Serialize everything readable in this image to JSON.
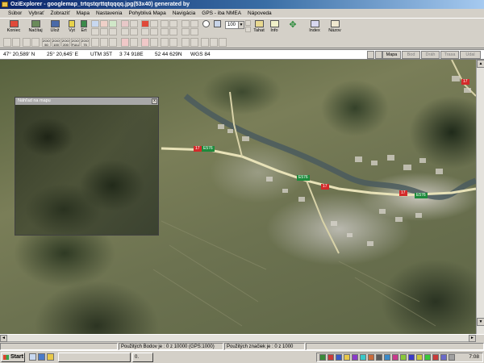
{
  "window": {
    "title": "OziExplorer - googlemap_trtqstqrttqtqqqq.jpg(53x40) generated by"
  },
  "menu": [
    "Súbor",
    "Vybrať",
    "Zobraziť",
    "Mapa",
    "Nastavenia",
    "Pohyblivá Mapa",
    "Navigácia",
    "GPS - iba NMEA",
    "Nápoveda"
  ],
  "toolbar": {
    "buttons": [
      {
        "label": "Koniec",
        "icon": "exit-icon"
      },
      {
        "label": "Načítaj",
        "icon": "load-map-icon"
      },
      {
        "label": "Ulož",
        "icon": "save-icon"
      },
      {
        "label": "Vyt",
        "icon": "create-icon"
      },
      {
        "label": "Ert",
        "icon": "edit-icon"
      },
      {
        "label": "Tahat",
        "icon": "drag-hand-icon"
      },
      {
        "label": "Info",
        "icon": "info-icon"
      },
      {
        "label": "Index",
        "icon": "index-icon"
      },
      {
        "label": "Názov",
        "icon": "name-search-icon"
      }
    ],
    "zoom_value": "100",
    "row2_labels": [
      "ZOOM 50",
      "ZOOM 100",
      "ZOOM 200",
      "ZOOM FULL",
      "ZOOM 75"
    ]
  },
  "coords": {
    "lat": "47° 20,589' N",
    "lon": "25° 20,645' E",
    "utm": "UTM  35T",
    "east": "3 74 918E",
    "north": "52 44 629N",
    "datum": "WGS 84",
    "buttons": [
      {
        "label": "Mapa",
        "enabled": true
      },
      {
        "label": "Bod",
        "enabled": false
      },
      {
        "label": "Dráh",
        "enabled": false
      },
      {
        "label": "Trasa",
        "enabled": false
      },
      {
        "label": "Udal",
        "enabled": false
      }
    ]
  },
  "overview": {
    "title": "Náhľad na mapu",
    "close": "x"
  },
  "map": {
    "road_labels": [
      "E576",
      "E576",
      "E576"
    ],
    "route_badges": [
      "17",
      "17",
      "17",
      "17"
    ]
  },
  "status": {
    "points": "Použitých Bodov je : 0 z 10000  (GPS:1000)",
    "markers": "Použitých značiek je : 0 z 1000"
  },
  "taskbar": {
    "start": "Start",
    "task1": "",
    "task2": "0.",
    "clock": "7:08"
  },
  "colors": {
    "title_bar": "#0a246a",
    "route_badge": "#d32a2a",
    "road_label": "#1e8a3c"
  }
}
